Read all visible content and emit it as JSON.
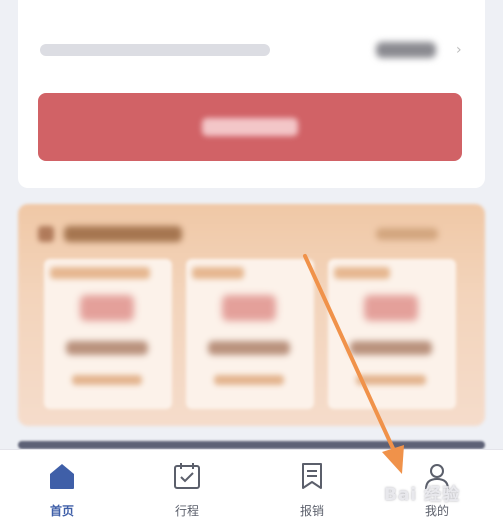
{
  "tabbar": {
    "items": [
      {
        "id": "home",
        "label": "首页",
        "icon": "home-icon",
        "active": true
      },
      {
        "id": "trip",
        "label": "行程",
        "icon": "calendar-check-icon",
        "active": false
      },
      {
        "id": "expense",
        "label": "报销",
        "icon": "receipt-icon",
        "active": false
      },
      {
        "id": "mine",
        "label": "我的",
        "icon": "user-icon",
        "active": false
      }
    ]
  },
  "watermark": {
    "text": "Bai 经验"
  },
  "colors": {
    "accent_red": "#d16266",
    "tab_active": "#3f5fa8",
    "tab_inactive": "#5b5f6b",
    "promo_bg": "#f0c8a6",
    "annotation_arrow": "#f0924a"
  }
}
